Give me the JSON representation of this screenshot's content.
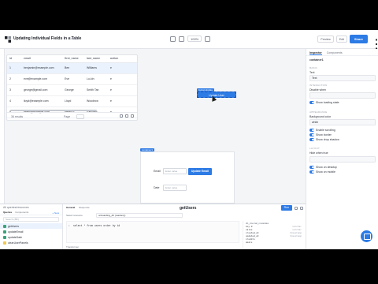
{
  "topbar": {
    "title": "Updating Individual Fields in a Table",
    "saved": "Saved",
    "zoom": "100%",
    "preview_label": "Preview",
    "history_label": "Edit",
    "share_label": "Share"
  },
  "table": {
    "columns": [
      "id",
      "email",
      "first_name",
      "last_name",
      "action"
    ],
    "rows": [
      [
        "1",
        "benjamin@example.com",
        "Ben",
        "Williams",
        "e"
      ],
      [
        "2",
        "eve@example.com",
        "Eve",
        "Lu-kin",
        "e"
      ],
      [
        "3",
        "george@gmail.com",
        "George",
        "Smith Tan",
        "e"
      ],
      [
        "4",
        "lloyd@example.com",
        "Lloyd",
        "Woodrow",
        "e"
      ],
      [
        "5",
        "helen@example.com",
        "Helen P",
        "Sanchez",
        "e"
      ]
    ],
    "count": "36 results",
    "page_label": "Page"
  },
  "update_button": {
    "tag": "buttonUpdate",
    "label": "Update User"
  },
  "form": {
    "tag": "container1",
    "email_label": "Email",
    "email_placeholder": "Enter value",
    "submit_label": "Update Email",
    "date_label": "Date",
    "date_placeholder": "Enter value"
  },
  "inspector": {
    "tabs": [
      "Inspector",
      "Components"
    ],
    "component_name": "container1",
    "sec_basic": "BASIC",
    "text_label": "Text",
    "text_value": "Text",
    "sec_interaction": "INTERACTION",
    "disable_label": "Disable when",
    "loading_label": "Show loading state",
    "sec_appearance": "APPEARANCE",
    "bg_label": "Background color",
    "bg_value": "white",
    "scroll_label": "Enable scrolling",
    "border_label": "Show border",
    "header_label": "Show drop shadow",
    "sec_layout": "LAYOUT",
    "hidden_label": "Hide when true",
    "desktop_label": "Show on desktop",
    "mobile_label": "Show on mobile"
  },
  "queries": {
    "header": "All queries/resources",
    "tabs": [
      "Queries",
      "Components"
    ],
    "add_label": "+ New",
    "search_placeholder": "Search (⌘F)",
    "items": [
      "getUsers",
      "updateEmail",
      "updateDate",
      "clearUserPanels"
    ]
  },
  "query_editor": {
    "tabs": [
      "General",
      "Response"
    ],
    "name": "getUsers",
    "run_label": "Run",
    "resource_label": "Select resource",
    "resource_value": "onboarding_db (readonly)",
    "line_no": "1",
    "code": "select * from users order by id",
    "transform_label": "Transformer",
    "state_title": "db_internal_metadata",
    "state_rows": [
      {
        "k": "key.0",
        "v": "varchar"
      },
      {
        "k": "value",
        "v": "varchar"
      },
      {
        "k": "created_at",
        "v": "timestamp"
      },
      {
        "k": "updated_at",
        "v": "timestamp"
      },
      {
        "k": "credits",
        "v": ""
      },
      {
        "k": "deals",
        "v": ""
      },
      {
        "k": "dog_walkers",
        "v": ""
      }
    ]
  },
  "colors": {
    "accent": "#2d7be5",
    "selected_row": "#eaf2fd"
  }
}
